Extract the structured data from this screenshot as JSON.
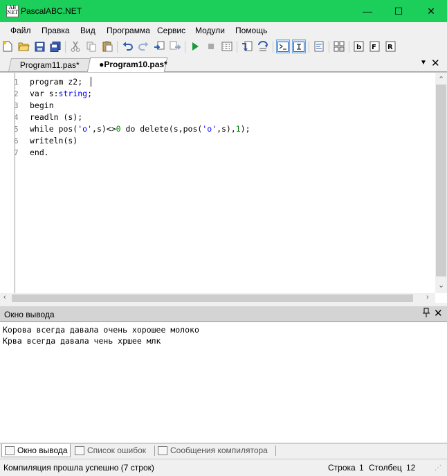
{
  "window": {
    "title": "PascalABC.NET",
    "app_icon_text": [
      "AB",
      "NET"
    ],
    "controls": {
      "minimize": "—",
      "maximize": "☐",
      "close": "✕"
    }
  },
  "menu": [
    "Файл",
    "Правка",
    "Вид",
    "Программа",
    "Сервис",
    "Модули",
    "Помощь"
  ],
  "toolbar": {
    "icons": [
      "new-file-icon",
      "open-icon",
      "save-icon",
      "save-all-icon",
      "cut-icon",
      "copy-icon",
      "paste-icon",
      "undo-icon",
      "redo-icon",
      "find-icon",
      "replace-icon",
      "run-icon",
      "stop-icon",
      "compile-icon",
      "step-into-icon",
      "step-over-icon",
      "console-icon",
      "debug-mode-icon",
      "format-icon",
      "module-icon",
      "template-icon",
      "form-icon",
      "help-icon"
    ]
  },
  "tabs": [
    {
      "label": "Program11.pas*",
      "active": false
    },
    {
      "label": "●Program10.pas*",
      "active": true
    }
  ],
  "tabstrip_controls": {
    "dropdown": "▼",
    "close": "✕"
  },
  "editor": {
    "line_numbers": [
      "1",
      "2",
      "3",
      "4",
      "5",
      "6",
      "7"
    ],
    "lines": [
      [
        {
          "t": "program z2;",
          "c": "kw"
        }
      ],
      [
        {
          "t": "var s:",
          "c": "kw"
        },
        {
          "t": "string",
          "c": "type"
        },
        {
          "t": ";",
          "c": "kw"
        }
      ],
      [
        {
          "t": "begin",
          "c": "kw"
        }
      ],
      [
        {
          "t": "readln (s);",
          "c": "kw"
        }
      ],
      [
        {
          "t": "while pos(",
          "c": "kw"
        },
        {
          "t": "'o'",
          "c": "str"
        },
        {
          "t": ",s)<>",
          "c": "kw"
        },
        {
          "t": "0",
          "c": "num"
        },
        {
          "t": " do delete(s,pos(",
          "c": "kw"
        },
        {
          "t": "'o'",
          "c": "str"
        },
        {
          "t": ",s),",
          "c": "kw"
        },
        {
          "t": "1",
          "c": "num"
        },
        {
          "t": ");",
          "c": "kw"
        }
      ],
      [
        {
          "t": "writeln(s)",
          "c": "kw"
        }
      ],
      [
        {
          "t": "end.",
          "c": "kw"
        }
      ]
    ]
  },
  "output_panel": {
    "title": "Окно вывода",
    "pin": "📌",
    "close": "✕",
    "lines": [
      "Корова всегда давала очень хорошее молоко",
      "Крва всегда давала чень хршее млк"
    ]
  },
  "bottom_tabs": [
    "Окно вывода",
    "Список ошибок",
    "Сообщения компилятора"
  ],
  "status": {
    "message": "Компиляция прошла успешно (7 строк)",
    "line_label": "Строка",
    "line_value": "1",
    "col_label": "Столбец",
    "col_value": "12"
  }
}
